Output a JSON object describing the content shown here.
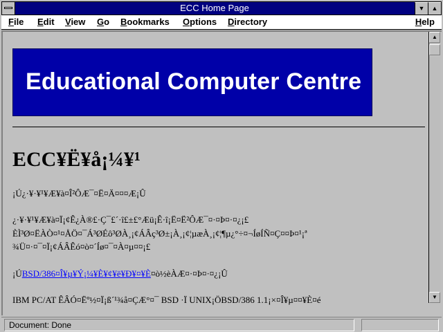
{
  "window": {
    "title": "ECC Home Page",
    "min_glyph": "▼",
    "max_glyph": "▲"
  },
  "menu": {
    "file": {
      "u": "F",
      "rest": "ile"
    },
    "edit": {
      "u": "E",
      "rest": "dit"
    },
    "view": {
      "u": "V",
      "rest": "iew"
    },
    "go": {
      "u": "G",
      "rest": "o"
    },
    "bookmarks": {
      "u": "B",
      "rest": "ookmarks"
    },
    "options": {
      "u": "O",
      "rest": "ptions"
    },
    "directory": {
      "u": "D",
      "rest": "irectory"
    },
    "help": {
      "u": "H",
      "rest": "elp"
    }
  },
  "content": {
    "banner_text": "Educational Computer Centre",
    "heading": "ECC¥Ë¥å¡¼¥¹",
    "line1": "¡Ú¿·¥·¥¹¥Æ¥à¤Î²ÔÆ¯¤Ë¤Ä¤¤¤Æ¡Û",
    "line2": "¿·¥·¥¹¥Æ¥à¤Ï¡¢Ê¿À®£·Ç¯£´·î£±£°Æü¡Ê·î¡Ë¤Ë²ÔÆ¯¤·¤Þ¤·¤¿¡£",
    "line3": "ÈÌ³Ø¤ËÀÒ¤¹¤ÅÖ¤¯Á³ØÉô³ØÀ¸¡¢ÁÂç³Ø±¡À¸¡¢¦µæÀ¸¡¢¦¶µ¿°÷¤¬Íø­ÍÑ¤Ç¤­¤Þ¤¹¡ª",
    "line4": "¾Ü¤·¤¯¤Ï¡¢ÁÂÊó¤ò¤´Íø¤¯¤À¤µ¤¤¡£",
    "line5_prefix": "¡Ú",
    "line5_link": "BSD/386¤Î¥µ¥Ý¡¼¥È¥¢¥ë¥Ð¥¤¥È",
    "line5_suffix": "¤ò½èÀÆ¤·¤Þ¤·¤¿¡Û",
    "line6": "IBM PC/AT ÊÂÓ¤Ëº½¤Ï¡ß´¹¾å¤ÇÆ°¤¯ BSD ·Ï UNIX¡ÖBSD/386 1.1¡×¤Î¥µ¤¤¥È¤é"
  },
  "status": {
    "text": "Document: Done"
  }
}
